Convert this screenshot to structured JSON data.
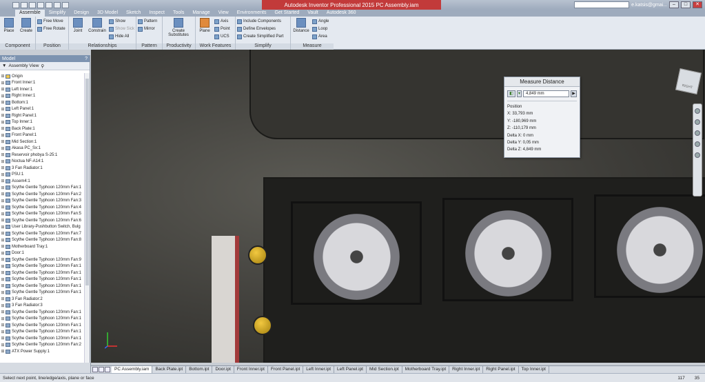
{
  "titlebar": {
    "title": "Autodesk Inventor Professional 2015   PC Assembly.iam",
    "user": "e.katsis@gmai..."
  },
  "menu_tabs": [
    "Assemble",
    "Simplify",
    "Design",
    "3D Model",
    "Sketch",
    "Inspect",
    "Tools",
    "Manage",
    "View",
    "Environments",
    "Get Started",
    "Vault",
    "Autodesk 360"
  ],
  "ribbon": {
    "component": {
      "name": "Component",
      "place": "Place",
      "create": "Create"
    },
    "position": {
      "name": "Position",
      "free_move": "Free Move",
      "free_rotate": "Free Rotate"
    },
    "relationships": {
      "name": "Relationships",
      "joint": "Joint",
      "constrain": "Constrain",
      "show": "Show",
      "show_sick": "Show Sick",
      "hide_all": "Hide All"
    },
    "pattern": {
      "name": "Pattern",
      "pattern": "Pattern",
      "mirror": "Mirror"
    },
    "productivity": {
      "name": "Productivity",
      "create_substitutes": "Create Substitutes"
    },
    "work_features": {
      "name": "Work Features",
      "plane": "Plane",
      "axis": "Axis",
      "point": "Point",
      "ucs": "UCS"
    },
    "simplify": {
      "name": "Simplify",
      "include_components": "Include Components",
      "define_envelopes": "Define Envelopes",
      "create_simplified_part": "Create Simplified Part"
    },
    "measure": {
      "name": "Measure",
      "distance": "Distance",
      "angle": "Angle",
      "loop": "Loop",
      "area": "Area"
    }
  },
  "browser": {
    "title": "Model",
    "view": "Assembly View",
    "items": [
      "Origin",
      "Front Inner:1",
      "Left Inner:1",
      "Right Inner:1",
      "Bottom:1",
      "Left Panel:1",
      "Right Panel:1",
      "Top Inner:1",
      "Back Plate:1",
      "Front Panel:1",
      "Mid Section:1",
      "Akasa PC_Sx:1",
      "Reservoir phobya S-25:1",
      "Noctua NF-A14:1",
      "3 Fan Radiator:1",
      "PSU:1",
      "Assem4:1",
      "Scythe Gentle Typhoon 120mm Fan:1",
      "Scythe Gentle Typhoon 120mm Fan:2",
      "Scythe Gentle Typhoon 120mm Fan:3",
      "Scythe Gentle Typhoon 120mm Fan:4",
      "Scythe Gentle Typhoon 120mm Fan:5",
      "Scythe Gentle Typhoon 120mm Fan:6",
      "User Library-Pushbutton Switch, Bulg",
      "Scythe Gentle Typhoon 120mm Fan:7",
      "Scythe Gentle Typhoon 120mm Fan:8",
      "Motherboard Tray:1",
      "Door:1",
      "Scythe Gentle Typhoon 120mm Fan:9",
      "Scythe Gentle Typhoon 120mm Fan:1",
      "Scythe Gentle Typhoon 120mm Fan:1",
      "Scythe Gentle Typhoon 120mm Fan:1",
      "Scythe Gentle Typhoon 120mm Fan:1",
      "Scythe Gentle Typhoon 120mm Fan:1",
      "3 Fan Radiator:2",
      "3 Fan Radiator:3",
      "Scythe Gentle Typhoon 120mm Fan:1",
      "Scythe Gentle Typhoon 120mm Fan:1",
      "Scythe Gentle Typhoon 120mm Fan:1",
      "Scythe Gentle Typhoon 120mm Fan:1",
      "Scythe Gentle Typhoon 120mm Fan:1",
      "Scythe Gentle Typhoon 120mm Fan:2",
      "ATX Power Supply:1"
    ]
  },
  "measure_dialog": {
    "title": "Measure Distance",
    "value": "4,849 mm",
    "position_label": "Position",
    "x": "X: 33,793 mm",
    "y": "Y: -180,969 mm",
    "z": "Z: -110,179 mm",
    "dx": "Delta X: 0 mm",
    "dy": "Delta Y: 0,05 mm",
    "dz": "Delta Z: 4,849 mm"
  },
  "viewcube_label": "RIGHT",
  "doc_tabs": [
    "PC Assembly.iam",
    "Back Plate.ipt",
    "Bottom.ipt",
    "Door.ipt",
    "Front Inner.ipt",
    "Front Panel.ipt",
    "Left Inner.ipt",
    "Left Panel.ipt",
    "Mid Section.ipt",
    "Motherboard Tray.ipt",
    "Right Inner.ipt",
    "Right Panel.ipt",
    "Top Inner.ipt"
  ],
  "status": {
    "message": "Select next point, line/edge/axis, plane or face",
    "n1": "117",
    "n2": "35"
  }
}
